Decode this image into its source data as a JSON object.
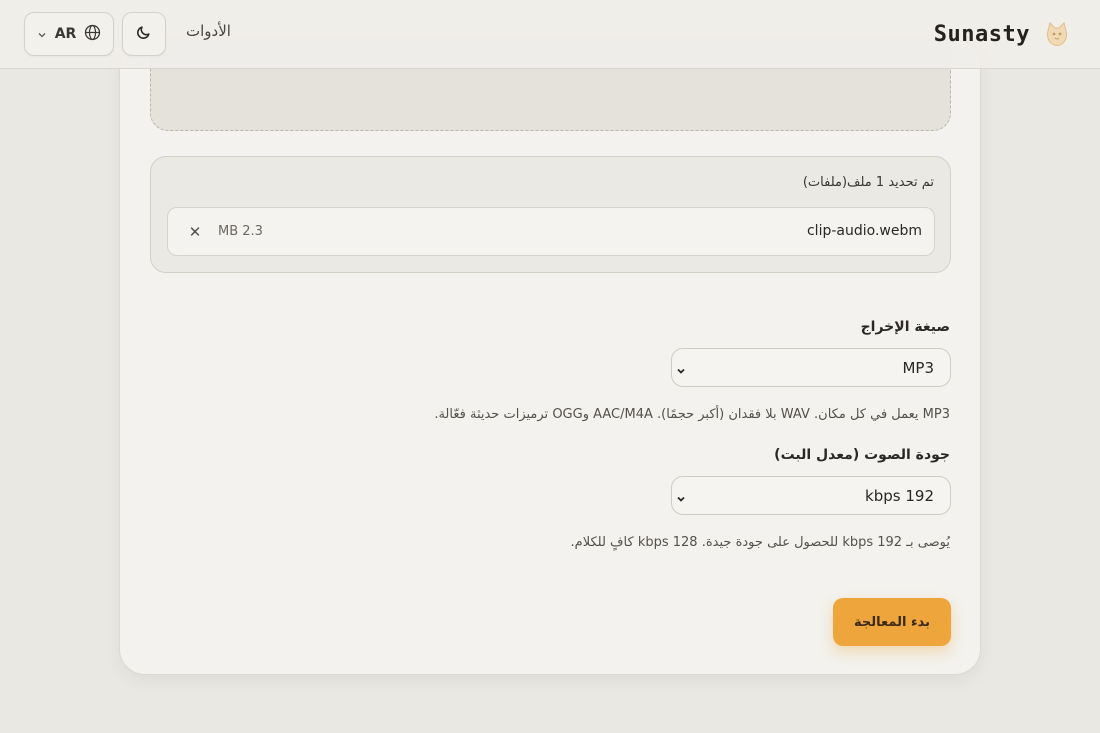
{
  "header": {
    "brand_name": "Sunasty",
    "nav_tools": "الأدوات",
    "lang_code": "AR"
  },
  "files": {
    "count_label": "تم تحديد 1 ملف(ملفات)",
    "items": [
      {
        "name": "clip-audio.webm",
        "size": "MB 2.3",
        "remove": "✕"
      }
    ]
  },
  "output_format": {
    "label": "صيغة الإخراج",
    "selected": "MP3",
    "help": "MP3 يعمل في كل مكان. WAV بلا فقدان (أكبر حجمًا). AAC/M4A وOGG ترميزات حديثة فعّالة."
  },
  "audio_quality": {
    "label": "جودة الصوت (معدل البت)",
    "selected": "kbps 192",
    "help": "يُوصى بـ kbps 192 للحصول على جودة جيدة. kbps 128 كافٍ للكلام."
  },
  "actions": {
    "start_label": "بدء المعالجة"
  },
  "colors": {
    "accent": "#eea53c",
    "background": "#eae8e3",
    "card": "#f3f2ee"
  }
}
